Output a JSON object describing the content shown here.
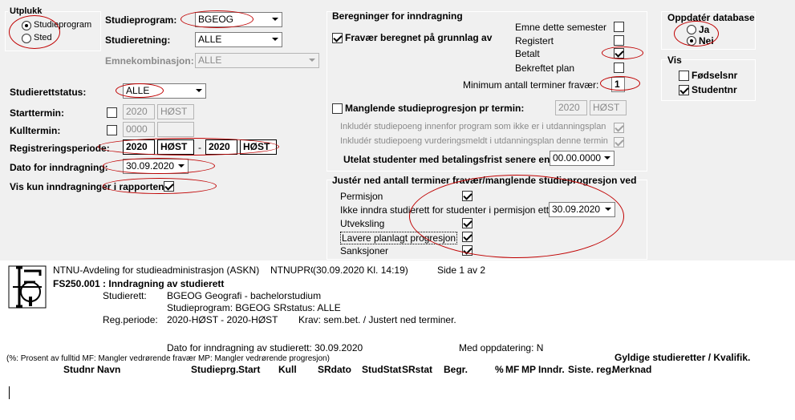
{
  "utplukk": {
    "title": "Utplukk",
    "options": [
      {
        "label": "Studieprogram",
        "checked": true
      },
      {
        "label": "Sted",
        "checked": false
      }
    ]
  },
  "form": {
    "studieprogram_label": "Studieprogram:",
    "studieprogram_value": "BGEOG",
    "studieretning_label": "Studieretning:",
    "studieretning_value": "ALLE",
    "emnekombinasjon_label": "Emnekombinasjon:",
    "emnekombinasjon_value": "ALLE",
    "studierettstatus_label": "Studierettstatus:",
    "studierettstatus_value": "ALLE",
    "starttermin_label": "Starttermin:",
    "starttermin_year": "2020",
    "starttermin_term": "HØST",
    "kulltermin_label": "Kulltermin:",
    "kulltermin_year": "0000",
    "kulltermin_term": "",
    "reg_label": "Registreringsperiode:",
    "reg_from_year": "2020",
    "reg_from_term": "HØST",
    "reg_sep": "-",
    "reg_to_year": "2020",
    "reg_to_term": "HØST",
    "dato_label": "Dato for inndragning:",
    "dato_value": "30.09.2020",
    "vis_kun_label": "Vis kun inndragninger i rapporten",
    "vis_kun_checked": true
  },
  "beregninger": {
    "title": "Beregninger for inndragning",
    "fravaer_label": "Fravær beregnet på grunnlag av",
    "fravaer_checked": true,
    "emne_label": "Emne dette semester",
    "registert_label": "Registert",
    "betalt_label": "Betalt",
    "betalt_checked": true,
    "bekreftet_label": "Bekreftet plan",
    "min_terminer_label": "Minimum antall terminer fravær:",
    "min_terminer_value": "1",
    "manglende_label": "Manglende studieprogresjon pr termin:",
    "manglende_year": "2020",
    "manglende_term": "HØST",
    "inkluder1_label": "Inkludér studiepoeng innenfor program som ikke er i utdanningsplan",
    "inkluder2_label": "Inkludér studiepoeng vurderingsmeldt i utdanningsplan denne termin",
    "utelat_label": "Utelat studenter med betalingsfrist senere enn",
    "utelat_value": "00.00.0000"
  },
  "juster": {
    "title": "Justér ned antall terminer fravær/manglende studieprogresjon ved",
    "permisjon_label": "Permisjon",
    "ikke_inndra_label": "Ikke inndra studierett for studenter i permisjon etter",
    "ikke_inndra_value": "30.09.2020",
    "utveksling_label": "Utveksling",
    "lavere_label": "Lavere planlagt progresjon",
    "sanksjoner_label": "Sanksjoner"
  },
  "oppdater": {
    "title": "Oppdatér database",
    "ja_label": "Ja",
    "nei_label": "Nei",
    "nei_checked": true
  },
  "vis": {
    "title": "Vis",
    "fodselsnr_label": "Fødselsnr",
    "fodselsnr_checked": false,
    "studentnr_label": "Studentnr",
    "studentnr_checked": true
  },
  "report": {
    "org": "NTNU-Avdeling for studieadministrasjon (ASKN)",
    "prog": "NTNUPROD",
    "stamp": "(30.09.2020 Kl. 14:19)",
    "page": "Side 1 av 2",
    "title": "FS250.001 : Inndragning av studierett",
    "studierett_label": "Studierett:",
    "studierett_value": "BGEOG Geografi - bachelorstudium",
    "studieprogram_line": "Studieprogram: BGEOG SRstatus: ALLE",
    "regperiode_label": "Reg.periode:",
    "regperiode_value": "2020-HØST - 2020-HØST",
    "krav": "Krav:  sem.bet. / Justert ned terminer.",
    "dato_line": "Dato for inndragning av studierett: 30.09.2020",
    "med_oppdatering": "Med oppdatering: N",
    "legend": "(%: Prosent av fulltid MF: Mangler vedrørende fravær MP: Mangler vedrørende progresjon)",
    "gyldige": "Gyldige studieretter / Kvalifik.",
    "columns": [
      "Studnr",
      "Navn",
      "Studieprg.",
      "Start",
      "Kull",
      "SRdato",
      "StudStat",
      "SRstat",
      "Begr.",
      "%",
      "MF",
      "MP",
      "Inndr.",
      "Siste. reg.",
      "Merknad"
    ]
  }
}
